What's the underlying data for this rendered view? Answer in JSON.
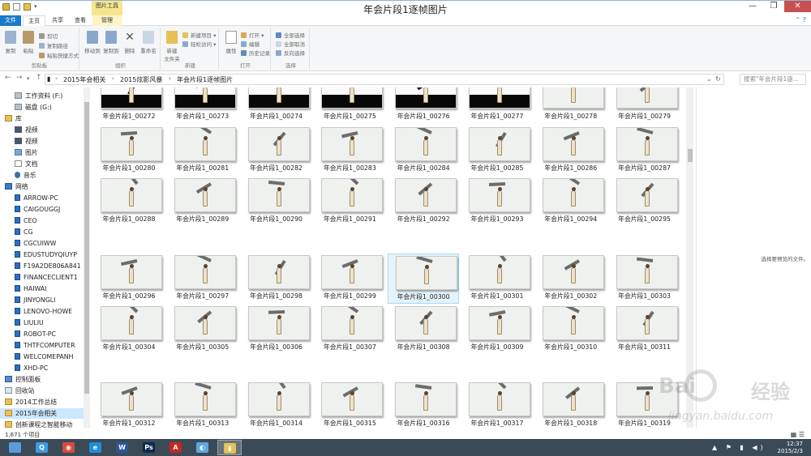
{
  "window": {
    "title": "年会片段1逐帧图片",
    "contextual_tab_group": "图片工具",
    "controls": {
      "minimize": "—",
      "maximize": "❐",
      "close": "✕"
    }
  },
  "ribbon": {
    "tabs": [
      "文件",
      "主页",
      "共享",
      "查看",
      "管理"
    ],
    "clipboard": {
      "label": "剪贴板",
      "copy": "复制",
      "paste": "粘贴",
      "cut": "剪切",
      "copy_path": "复制路径",
      "paste_shortcut": "粘贴快捷方式"
    },
    "organize": {
      "label": "组织",
      "move_to": "移动到",
      "copy_to": "复制到",
      "delete": "删除",
      "rename": "重命名"
    },
    "new": {
      "label": "新建",
      "new_folder": "新建\n文件夹",
      "new_item": "新建项目 ▾",
      "easy_access": "轻松访问 ▾"
    },
    "open": {
      "label": "打开",
      "properties": "属性",
      "open": "打开 ▾",
      "edit": "编辑",
      "history": "历史记录"
    },
    "select": {
      "label": "选择",
      "select_all": "全部选择",
      "select_none": "全部取消",
      "invert": "反向选择"
    }
  },
  "address": {
    "back": "←",
    "forward": "→",
    "up": "↑",
    "crumbs": [
      "2015年会相关",
      "2015炫影风暴",
      "年会片段1逐帧图片"
    ],
    "search_placeholder": "搜索\"年会片段1逐...",
    "refresh": "↻",
    "dropdown": "⌄"
  },
  "nav_items": [
    {
      "label": "工作资料 (F:)",
      "icon": "drive",
      "indent": 18
    },
    {
      "label": "磁盘 (G:)",
      "icon": "drive",
      "indent": 18
    },
    {
      "label": "库",
      "icon": "lib",
      "indent": 6
    },
    {
      "label": "视频",
      "icon": "vid",
      "indent": 18
    },
    {
      "label": "视频",
      "icon": "vid",
      "indent": 18
    },
    {
      "label": "图片",
      "icon": "pic",
      "indent": 18
    },
    {
      "label": "文档",
      "icon": "doc",
      "indent": 18
    },
    {
      "label": "音乐",
      "icon": "music",
      "indent": 18
    },
    {
      "label": "网络",
      "icon": "net",
      "indent": 6
    },
    {
      "label": "ARROW-PC",
      "icon": "pc",
      "indent": 18
    },
    {
      "label": "CAIGOUGGJ",
      "icon": "pc",
      "indent": 18
    },
    {
      "label": "CEO",
      "icon": "pc",
      "indent": 18
    },
    {
      "label": "CG",
      "icon": "pc",
      "indent": 18
    },
    {
      "label": "CGCUIWW",
      "icon": "pc",
      "indent": 18
    },
    {
      "label": "EDUSTUDYQIUYP",
      "icon": "pc",
      "indent": 18
    },
    {
      "label": "F19A2DE806A841",
      "icon": "pc",
      "indent": 18
    },
    {
      "label": "FINANCECLIENT1",
      "icon": "pc",
      "indent": 18
    },
    {
      "label": "HAIWAI",
      "icon": "pc",
      "indent": 18
    },
    {
      "label": "JINYONGLI",
      "icon": "pc",
      "indent": 18
    },
    {
      "label": "LENOVO-HOWE",
      "icon": "pc",
      "indent": 18
    },
    {
      "label": "LIULIU",
      "icon": "pc",
      "indent": 18
    },
    {
      "label": "ROBOT-PC",
      "icon": "pc",
      "indent": 18
    },
    {
      "label": "THTFCOMPUTER",
      "icon": "pc",
      "indent": 18
    },
    {
      "label": "WELCOMEPANH",
      "icon": "pc",
      "indent": 18
    },
    {
      "label": "XHD-PC",
      "icon": "pc",
      "indent": 18
    },
    {
      "label": "控制面板",
      "icon": "cp",
      "indent": 6
    },
    {
      "label": "回收站",
      "icon": "bin",
      "indent": 6
    },
    {
      "label": "2014工作总结",
      "icon": "folder",
      "indent": 6
    },
    {
      "label": "2015年会相关",
      "icon": "folder",
      "indent": 6,
      "selected": true
    },
    {
      "label": "创新课程之智能移动",
      "icon": "folder",
      "indent": 6
    }
  ],
  "files": [
    "年会片段1_00272",
    "年会片段1_00273",
    "年会片段1_00274",
    "年会片段1_00275",
    "年会片段1_00276",
    "年会片段1_00277",
    "年会片段1_00278",
    "年会片段1_00279",
    "年会片段1_00280",
    "年会片段1_00281",
    "年会片段1_00282",
    "年会片段1_00283",
    "年会片段1_00284",
    "年会片段1_00285",
    "年会片段1_00286",
    "年会片段1_00287",
    "年会片段1_00288",
    "年会片段1_00289",
    "年会片段1_00290",
    "年会片段1_00291",
    "年会片段1_00292",
    "年会片段1_00293",
    "年会片段1_00294",
    "年会片段1_00295",
    "年会片段1_00296",
    "年会片段1_00297",
    "年会片段1_00298",
    "年会片段1_00299",
    "年会片段1_00300",
    "年会片段1_00301",
    "年会片段1_00302",
    "年会片段1_00303",
    "年会片段1_00304",
    "年会片段1_00305",
    "年会片段1_00306",
    "年会片段1_00307",
    "年会片段1_00308",
    "年会片段1_00309",
    "年会片段1_00310",
    "年会片段1_00311",
    "年会片段1_00312",
    "年会片段1_00313",
    "年会片段1_00314",
    "年会片段1_00315",
    "年会片段1_00316",
    "年会片段1_00317",
    "年会片段1_00318",
    "年会片段1_00319"
  ],
  "selected_file": "年会片段1_00300",
  "preview_text": "选择要预览的文件。",
  "status": {
    "item_count": "1,671 个项目",
    "view_icons": "▦ ☰"
  },
  "taskbar": {
    "apps": [
      {
        "name": "explorer-start",
        "color": "#5a9bd8",
        "glyph": ""
      },
      {
        "name": "qq",
        "color": "#3c9be0",
        "glyph": "Q"
      },
      {
        "name": "chrome",
        "color": "#d94a38",
        "glyph": "◉"
      },
      {
        "name": "ie",
        "color": "#1e8ee0",
        "glyph": "e"
      },
      {
        "name": "word",
        "color": "#2b5797",
        "glyph": "W"
      },
      {
        "name": "photoshop",
        "color": "#0d2a4e",
        "glyph": "Ps"
      },
      {
        "name": "acrobat",
        "color": "#c8261e",
        "glyph": "A"
      },
      {
        "name": "paint",
        "color": "#5fa7e0",
        "glyph": "◐"
      },
      {
        "name": "file-explorer",
        "color": "#e7c05c",
        "glyph": "▮",
        "active": true
      }
    ],
    "tray": "▲ ⚑ ▮ ◀)",
    "time": "12:37",
    "date": "2015/2/3"
  },
  "watermark": {
    "logo": "Bai",
    "cn": "经验",
    "url": "jingyan.baidu.com"
  }
}
